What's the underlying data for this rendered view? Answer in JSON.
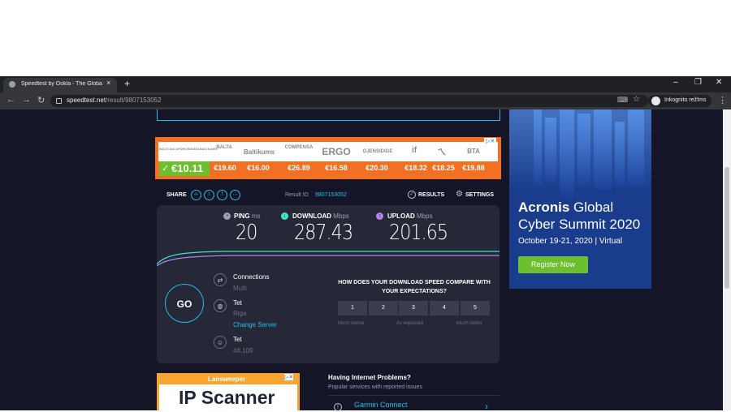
{
  "browser": {
    "tab_title": "Speedtest by Ookla - The Global",
    "tab_close": "×",
    "new_tab": "+",
    "url_host": "speedtest.net",
    "url_path": "/result/9807153052",
    "incognito_label": "Inkognito režīms",
    "window_controls": [
      "–",
      "❐",
      "✕"
    ]
  },
  "ad_banner": {
    "best_price": "€10.11",
    "logos": [
      "BALTIJAS APDROŠINĀŠANAS NAMS",
      "BALTA",
      "Baltikums",
      "COMPENSA",
      "ERGO",
      "GJENSIDIGE",
      "if",
      "ㄟ",
      "BTA"
    ],
    "prices": [
      "€19.60",
      "€16.00",
      "€26.89",
      "€16.58",
      "€20.30",
      "€18.32",
      "€18.25",
      "€19.88"
    ],
    "adchoice": "▷✕"
  },
  "share": {
    "label": "SHARE",
    "result_label": "Result ID",
    "result_id": "9807153052",
    "results_label": "RESULTS",
    "settings_label": "SETTINGS"
  },
  "metrics": {
    "ping": {
      "label": "PING",
      "unit": "ms",
      "value": "20"
    },
    "download": {
      "label": "DOWNLOAD",
      "unit": "Mbps",
      "value": "287.43"
    },
    "upload": {
      "label": "UPLOAD",
      "unit": "Mbps",
      "value": "201.65"
    }
  },
  "go_label": "GO",
  "connections": {
    "title": "Connections",
    "value": "Multi"
  },
  "isp": {
    "title": "Tet",
    "location": "Riga",
    "change_server": "Change Server"
  },
  "host": {
    "title": "Tet",
    "ip": "46.109"
  },
  "survey": {
    "question": "HOW DOES YOUR DOWNLOAD SPEED COMPARE WITH YOUR EXPECTATIONS?",
    "options": [
      "1",
      "2",
      "3",
      "4",
      "5"
    ],
    "captions": [
      "Much worse",
      "As expected",
      "Much better"
    ]
  },
  "lansweeper_ad": {
    "brand": "Lansweeper",
    "title": "IP Scanner"
  },
  "problems": {
    "title": "Having Internet Problems?",
    "subtitle": "Popular services with reported issues",
    "first_service": "Garmin Connect"
  },
  "acronis_ad": {
    "brand": "Acronis",
    "title_rest": " Global Cyber Summit 2020",
    "date": "October 19-21, 2020 | Virtual",
    "button": "Register Now"
  },
  "colors": {
    "accent": "#1ec1e6",
    "page_bg": "#141526",
    "panel_bg": "#262838",
    "ad_orange": "#f36f21",
    "green": "#6cbf2d"
  }
}
